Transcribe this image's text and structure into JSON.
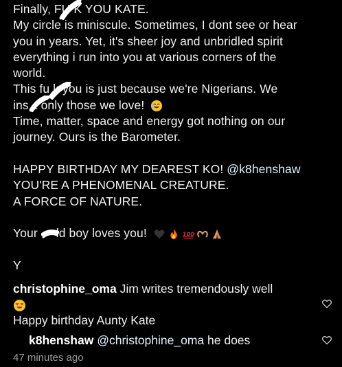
{
  "caption": {
    "line1": "Finally, FU  K YOU KATE.",
    "line2": "My circle is miniscule. Sometimes, I dont see or hear",
    "line3": "you in years. Yet, it's sheer joy and unbridled spirit",
    "line4": "everything i run into you at various corners of the",
    "line5": "world.",
    "line6": "This fu  k you is just because we're Nigerians. We",
    "line7_a": "ins",
    "line7_b": "t only those we love!",
    "line8": "Time, matter, space and energy got nothing on our",
    "line9": "journey. Ours is the Barometer.",
    "line10_a": "HAPPY BIRTHDAY MY DEAREST KO! ",
    "line10_mention": "@k8henshaw",
    "line11": "YOU'RE A PHENOMENAL CREATURE.",
    "line12": "A FORCE OF NATURE.",
    "line13_a": "Your ",
    "line13_b": "ld boy loves you!",
    "line14": "Y"
  },
  "comments": [
    {
      "username": "christophine_oma",
      "text": "Jim writes tremendously well"
    },
    {
      "text": "Happy birthday Aunty Kate"
    }
  ],
  "reply": {
    "username": "k8henshaw",
    "mention": "@christophine_oma",
    "text": "he does"
  },
  "timestamp": "47 minutes ago",
  "colors": {
    "background": "#000000",
    "text": "#f2f2f2",
    "muted": "#9a9a9a"
  },
  "icons": [
    "heart-outline-icon",
    "heart-outline-icon"
  ]
}
